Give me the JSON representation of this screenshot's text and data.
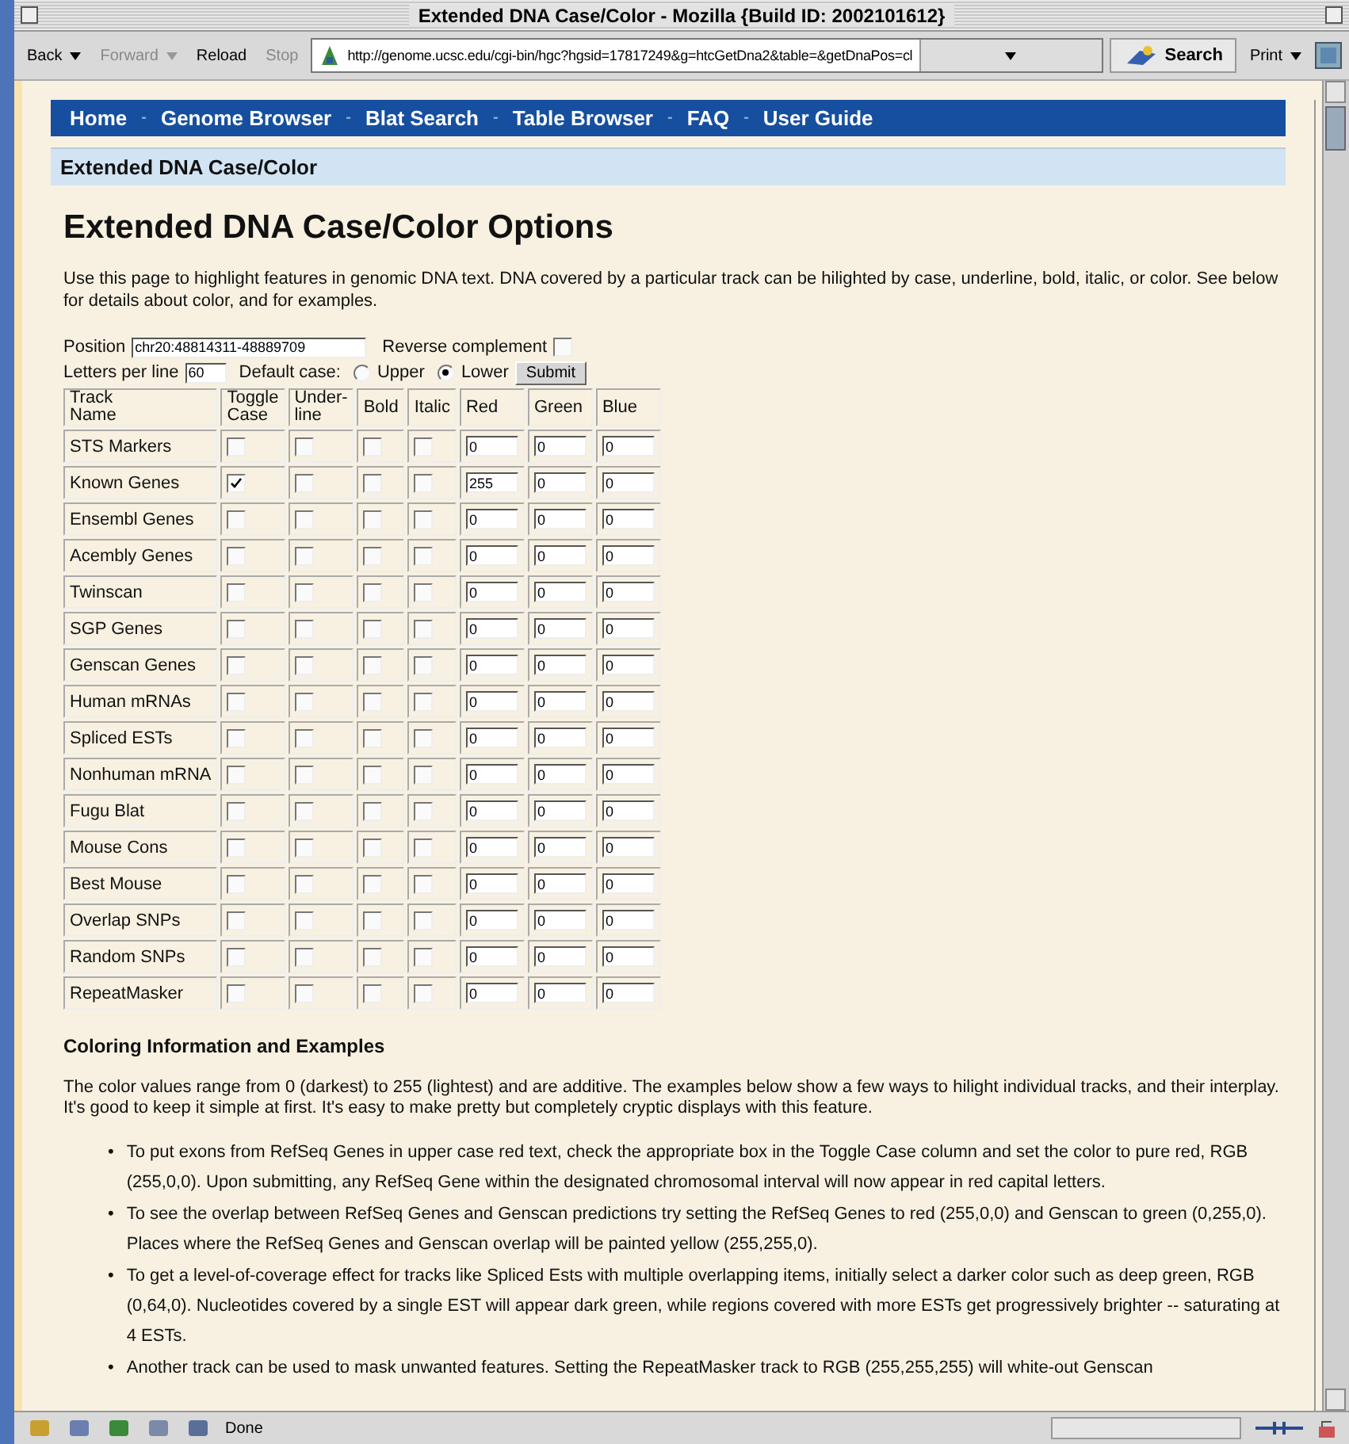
{
  "window": {
    "title": "Extended DNA Case/Color - Mozilla {Build ID: 2002101612}"
  },
  "toolbar": {
    "buttons": [
      {
        "label": "Back",
        "disabled": false,
        "menu": true
      },
      {
        "label": "Forward",
        "disabled": true,
        "menu": true
      },
      {
        "label": "Reload",
        "disabled": false,
        "menu": false
      },
      {
        "label": "Stop",
        "disabled": true,
        "menu": false
      }
    ],
    "url": "http://genome.ucsc.edu/cgi-bin/hgc?hgsid=17817249&g=htcGetDna2&table=&getDnaPos=cl",
    "search": "Search",
    "print": "Print"
  },
  "nav": {
    "separator": "-",
    "items": [
      "Home",
      "Genome Browser",
      "Blat Search",
      "Table Browser",
      "FAQ",
      "User Guide"
    ]
  },
  "section_header": "Extended DNA Case/Color",
  "heading": "Extended DNA Case/Color Options",
  "intro": "Use this page to highlight features in genomic DNA text. DNA covered by a particular track can be hilighted by case, underline, bold, italic, or color. See below for details about color, and for examples.",
  "form": {
    "position_label": "Position",
    "position": "chr20:48814311-48889709",
    "reverse_label": "Reverse complement",
    "reverse_checked": false,
    "letters_label": "Letters per line",
    "letters": "60",
    "case_label": "Default case:",
    "case_options": [
      {
        "label": "Upper",
        "selected": false
      },
      {
        "label": "Lower",
        "selected": true
      }
    ],
    "submit": "Submit"
  },
  "table": {
    "columns": [
      "Track Name",
      "Toggle Case",
      "Under- line",
      "Bold",
      "Italic",
      "Red",
      "Green",
      "Blue"
    ],
    "rows": [
      {
        "name": "STS Markers",
        "toggle_case": false,
        "underline": false,
        "bold": false,
        "italic": false,
        "red": "0",
        "green": "0",
        "blue": "0"
      },
      {
        "name": "Known Genes",
        "toggle_case": true,
        "underline": false,
        "bold": false,
        "italic": false,
        "red": "255",
        "green": "0",
        "blue": "0"
      },
      {
        "name": "Ensembl Genes",
        "toggle_case": false,
        "underline": false,
        "bold": false,
        "italic": false,
        "red": "0",
        "green": "0",
        "blue": "0"
      },
      {
        "name": "Acembly Genes",
        "toggle_case": false,
        "underline": false,
        "bold": false,
        "italic": false,
        "red": "0",
        "green": "0",
        "blue": "0"
      },
      {
        "name": "Twinscan",
        "toggle_case": false,
        "underline": false,
        "bold": false,
        "italic": false,
        "red": "0",
        "green": "0",
        "blue": "0"
      },
      {
        "name": "SGP Genes",
        "toggle_case": false,
        "underline": false,
        "bold": false,
        "italic": false,
        "red": "0",
        "green": "0",
        "blue": "0"
      },
      {
        "name": "Genscan Genes",
        "toggle_case": false,
        "underline": false,
        "bold": false,
        "italic": false,
        "red": "0",
        "green": "0",
        "blue": "0"
      },
      {
        "name": "Human mRNAs",
        "toggle_case": false,
        "underline": false,
        "bold": false,
        "italic": false,
        "red": "0",
        "green": "0",
        "blue": "0"
      },
      {
        "name": "Spliced ESTs",
        "toggle_case": false,
        "underline": false,
        "bold": false,
        "italic": false,
        "red": "0",
        "green": "0",
        "blue": "0"
      },
      {
        "name": "Nonhuman mRNA",
        "toggle_case": false,
        "underline": false,
        "bold": false,
        "italic": false,
        "red": "0",
        "green": "0",
        "blue": "0"
      },
      {
        "name": "Fugu Blat",
        "toggle_case": false,
        "underline": false,
        "bold": false,
        "italic": false,
        "red": "0",
        "green": "0",
        "blue": "0"
      },
      {
        "name": "Mouse Cons",
        "toggle_case": false,
        "underline": false,
        "bold": false,
        "italic": false,
        "red": "0",
        "green": "0",
        "blue": "0"
      },
      {
        "name": "Best Mouse",
        "toggle_case": false,
        "underline": false,
        "bold": false,
        "italic": false,
        "red": "0",
        "green": "0",
        "blue": "0"
      },
      {
        "name": "Overlap SNPs",
        "toggle_case": false,
        "underline": false,
        "bold": false,
        "italic": false,
        "red": "0",
        "green": "0",
        "blue": "0"
      },
      {
        "name": "Random SNPs",
        "toggle_case": false,
        "underline": false,
        "bold": false,
        "italic": false,
        "red": "0",
        "green": "0",
        "blue": "0"
      },
      {
        "name": "RepeatMasker",
        "toggle_case": false,
        "underline": false,
        "bold": false,
        "italic": false,
        "red": "0",
        "green": "0",
        "blue": "0"
      }
    ]
  },
  "coloring": {
    "heading": "Coloring Information and Examples",
    "paragraph": "The color values range from 0 (darkest) to 255 (lightest) and are additive. The examples below show a few ways to hilight individual tracks, and their interplay. It's good to keep it simple at first. It's easy to make pretty but completely cryptic displays with this feature.",
    "marker": "•",
    "bullets": [
      "To put exons from RefSeq Genes in upper case red text, check the appropriate box in the Toggle Case column and set the color to pure red, RGB (255,0,0). Upon submitting, any RefSeq Gene within the designated chromosomal interval will now appear in red capital letters.",
      "To see the overlap between RefSeq Genes and Genscan predictions try setting the RefSeq Genes to red (255,0,0) and Genscan to green (0,255,0). Places where the RefSeq Genes and Genscan overlap will be painted yellow (255,255,0).",
      "To get a level-of-coverage effect for tracks like Spliced Ests with multiple overlapping items, initially select a darker color such as deep green, RGB (0,64,0). Nucleotides covered by a single EST will appear dark green, while regions covered with more ESTs get progressively brighter -- saturating at 4 ESTs.",
      "Another track can be used to mask unwanted features. Setting the RepeatMasker track to RGB (255,255,255) will white-out Genscan"
    ]
  },
  "status": "Done",
  "progress": {
    "level": 0
  }
}
